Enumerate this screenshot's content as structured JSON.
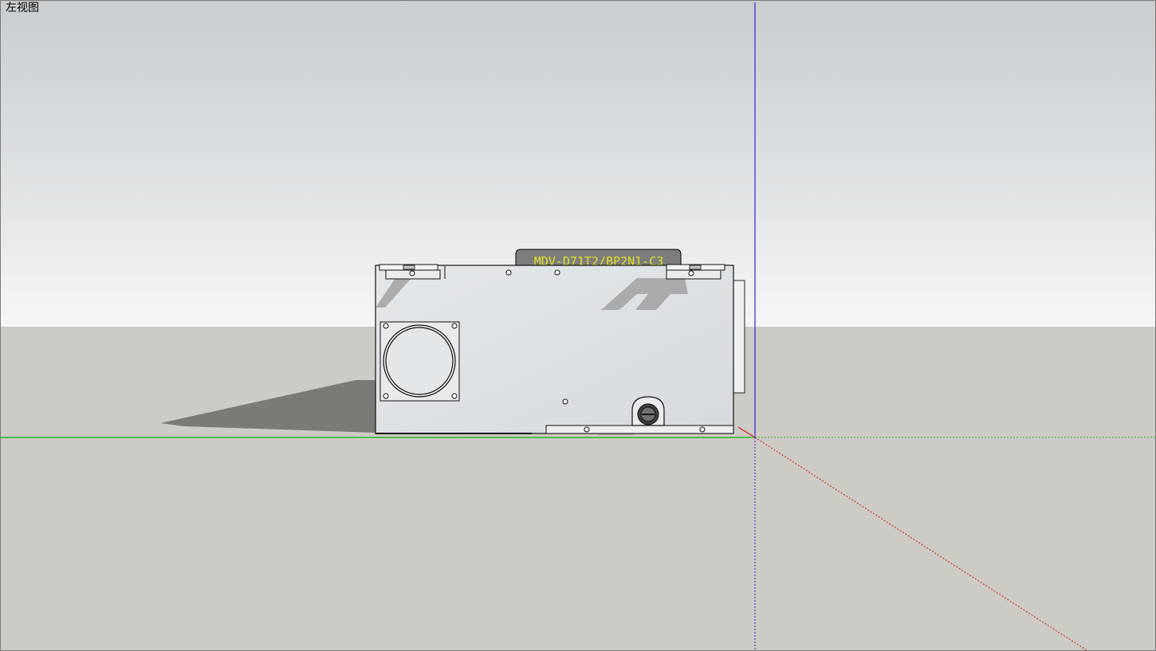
{
  "viewport": {
    "view_name": "左视图"
  },
  "model": {
    "nameplate_text": "MDV-D71T2/BP2N1-C3"
  },
  "colors": {
    "sky_top": "#c9cdd0",
    "sky_bottom": "#f5f6f7",
    "ground": "#cccbc5",
    "green_axis": "#2db52d",
    "blue_axis": "#2a2ad6",
    "red_axis": "#d21c1c",
    "nameplate_text": "#e3df2a"
  }
}
